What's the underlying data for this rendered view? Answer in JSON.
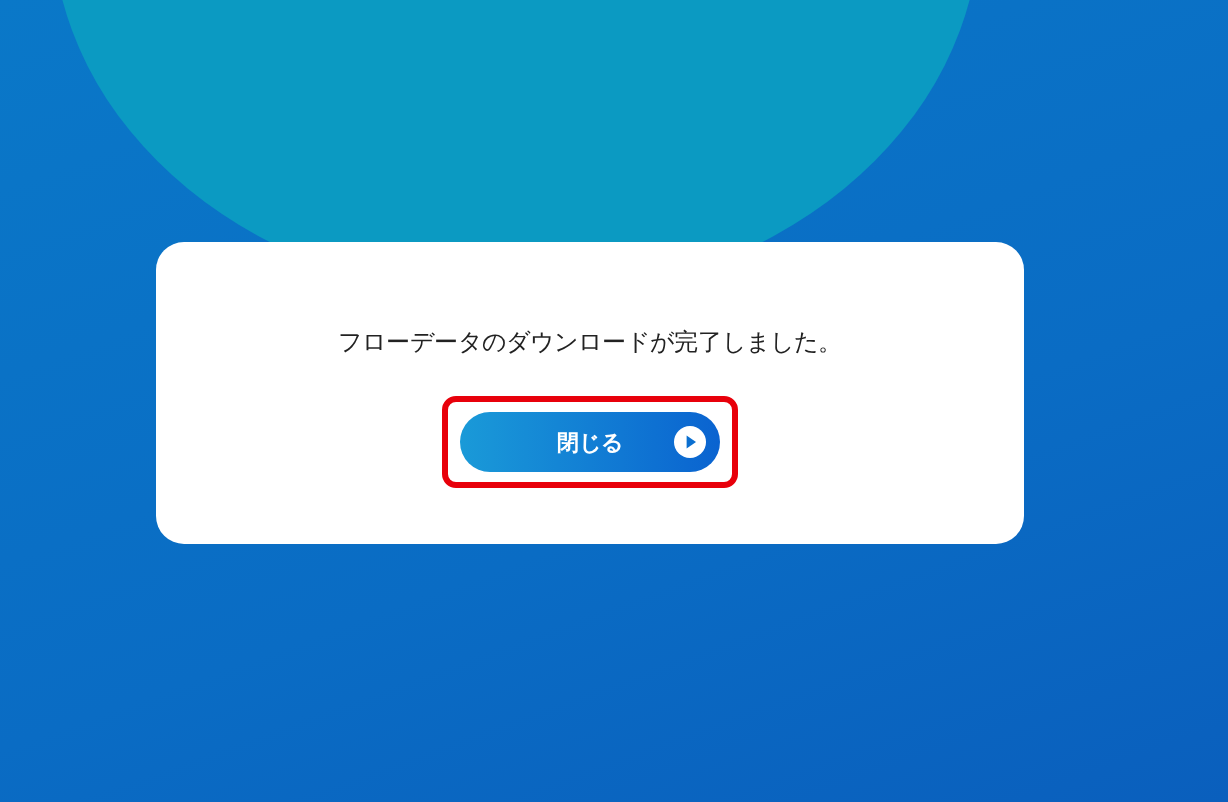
{
  "dialog": {
    "message": "フローデータのダウンロードが完了しました。",
    "button": {
      "label": "閉じる",
      "highlighted": true
    }
  }
}
